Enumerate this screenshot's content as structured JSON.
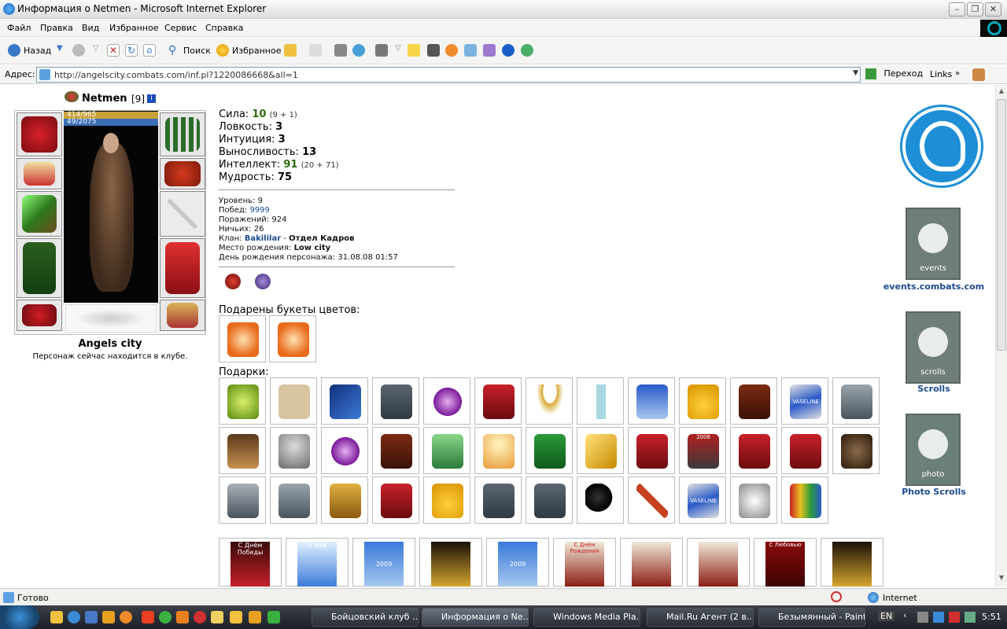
{
  "window": {
    "title": "Информация о Netmen - Microsoft Internet Explorer"
  },
  "menu": [
    "Файл",
    "Правка",
    "Вид",
    "Избранное",
    "Сервис",
    "Справка"
  ],
  "toolbar": {
    "back": "Назад",
    "search": "Поиск",
    "favorites": "Избранное"
  },
  "address": {
    "label": "Адрес:",
    "url": "http://angelscity.combats.com/inf.pl?1220086668&all=1",
    "go": "Переход",
    "links": "Links"
  },
  "character": {
    "name": "Netmen",
    "level_badge": "[9]",
    "hp": "414/965",
    "mp": "49/2075",
    "city": "Angels city",
    "location_note": "Персонаж сейчас находится в клубе."
  },
  "stats": [
    {
      "label": "Сила:",
      "value": "10",
      "extra": "(9 + 1)"
    },
    {
      "label": "Ловкость:",
      "value": "3",
      "extra": ""
    },
    {
      "label": "Интуиция:",
      "value": "3",
      "extra": ""
    },
    {
      "label": "Выносливость:",
      "value": "13",
      "extra": ""
    },
    {
      "label": "Интеллект:",
      "value": "91",
      "extra": "(20 + 71)"
    },
    {
      "label": "Мудрость:",
      "value": "75",
      "extra": ""
    }
  ],
  "info": {
    "level": {
      "label": "Уровень:",
      "value": "9"
    },
    "wins": {
      "label": "Побед:",
      "value": "9999"
    },
    "losses": {
      "label": "Поражений:",
      "value": "924"
    },
    "draws": {
      "label": "Ничьих:",
      "value": "26"
    },
    "clan": {
      "label": "Клан:",
      "value": "Bakililar",
      "sep": "-",
      "dept": "Отдел Кадров"
    },
    "birthplace": {
      "label": "Место рождения:",
      "value": "Low city"
    },
    "birthday": {
      "label": "День рождения персонажа:",
      "value": "31.08.08 01:57"
    }
  },
  "sections": {
    "flowers": "Подарены букеты цветов:",
    "gifts": "Подарки:"
  },
  "right_links": {
    "events": "events.combats.com",
    "events_banner": "events",
    "scrolls": "Scrolls",
    "scrolls_banner": "scrolls",
    "photo": "Photo Scrolls",
    "photo_banner": "photo"
  },
  "card_texts": [
    "С Днём Победы",
    "9 мая",
    "2009",
    "",
    "2009",
    "С Днём Рождения",
    "",
    "",
    "С Любовью",
    ""
  ],
  "gift_labels": {
    "poster": "2006",
    "cream": "VASELINE"
  },
  "status": {
    "text": "Готово",
    "zone": "Internet"
  },
  "taskbar": {
    "items": [
      "Бойцовский клуб ...",
      "Информация о Ne...",
      "Windows Media Pla...",
      "Mail.Ru Агент (2 в...",
      "Безымянный - Paint"
    ],
    "lang": "EN",
    "time": "5:51"
  }
}
